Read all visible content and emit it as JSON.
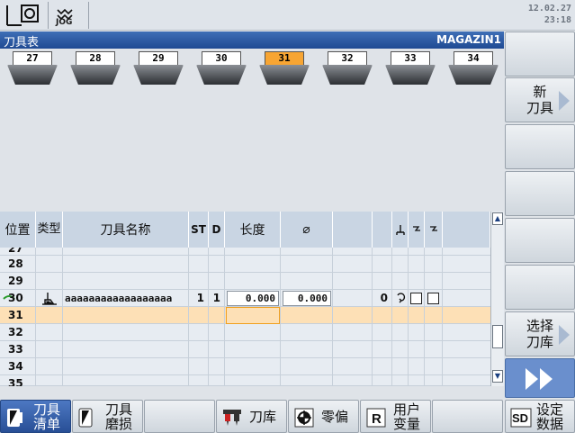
{
  "status_bar": {
    "mode": "JOG",
    "date": "12.02.27",
    "time": "23:18",
    "icons": [
      "reference-point-icon",
      "jog-mode-icon"
    ]
  },
  "title_bar": {
    "title": "刀具表",
    "magazine": "MAGAZIN1"
  },
  "magazine": {
    "pockets": [
      "27",
      "28",
      "29",
      "30",
      "31",
      "32",
      "33",
      "34"
    ],
    "active_pocket": "31"
  },
  "table": {
    "headers": {
      "position": "位置",
      "type": "类型",
      "name": "刀具名称",
      "st": "ST",
      "d": "D",
      "length": "长度",
      "diameter": "⌀"
    },
    "rows": [
      {
        "pos": "27",
        "partial": true
      },
      {
        "pos": "28"
      },
      {
        "pos": "29"
      },
      {
        "pos": "30",
        "type_icon": "tool-type-icon",
        "name": "aaaaaaaaaaaaaaaaaa",
        "st": "1",
        "d": "1",
        "length": "0.000",
        "diameter": "0.000",
        "extra": "0"
      },
      {
        "pos": "31",
        "selected": true
      },
      {
        "pos": "32"
      },
      {
        "pos": "33"
      },
      {
        "pos": "34"
      },
      {
        "pos": "35",
        "partial": true
      }
    ]
  },
  "right_softkeys": [
    {
      "line1": "新",
      "line2": "刀具",
      "arrow": true
    },
    {
      "line1": "选择",
      "line2": "刀库",
      "arrow": true
    }
  ],
  "bottom_softkeys": {
    "tool_list_1": "刀具",
    "tool_list_2": "清单",
    "tool_wear_1": "刀具",
    "tool_wear_2": "磨损",
    "magazine": "刀库",
    "work_offset": "零偏",
    "user_var_1": "用户",
    "user_var_2": "变量",
    "settings_1": "设定",
    "settings_2": "数据"
  },
  "colors": {
    "title_bar": "#2a56a0",
    "active_pocket": "#f7a533",
    "selected_row": "#fde0b6",
    "active_softkey": "#3a64ad"
  }
}
